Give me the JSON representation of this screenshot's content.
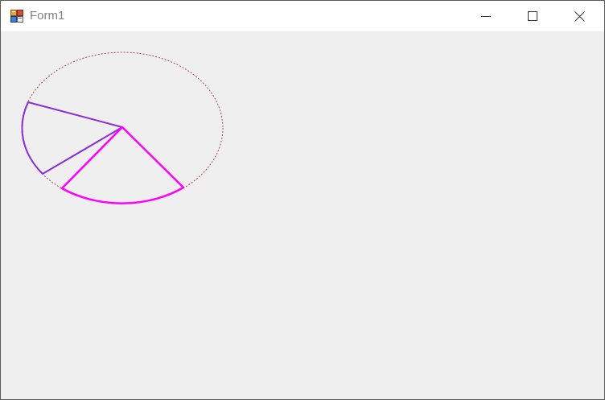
{
  "window": {
    "title": "Form1",
    "icons": {
      "app": "form-app-icon",
      "minimize": "minimize-icon",
      "maximize": "maximize-icon",
      "close": "close-icon"
    }
  },
  "drawing": {
    "ellipse_color": "#b04848",
    "slice_1_color": "#8a2be2",
    "slice_2_color": "#ff00ff",
    "client_background": "#efefef"
  }
}
